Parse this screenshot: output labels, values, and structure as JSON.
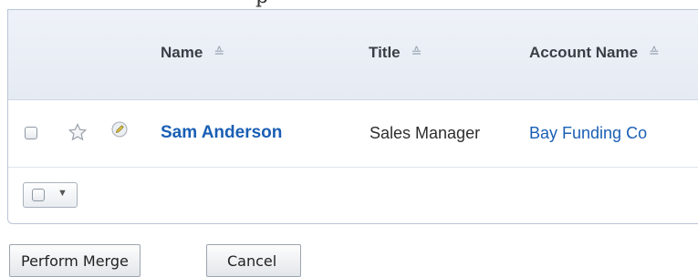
{
  "table": {
    "columns": [
      {
        "label": "Name"
      },
      {
        "label": "Title"
      },
      {
        "label": "Account Name"
      }
    ],
    "rows": [
      {
        "name": "Sam Anderson",
        "title": "Sales Manager",
        "account_name": "Bay Funding Co",
        "favorite": false
      }
    ]
  },
  "icons": {
    "sort": "sort-icon",
    "favorite": "star-icon",
    "edit": "pencil-edit-icon",
    "dropdown": "chevron-down-icon"
  },
  "colors": {
    "link": "#1a5fb4",
    "header_bg": "#eef2f8",
    "border": "#b8c4d6"
  },
  "actions": {
    "perform_merge_label": "Perform Merge",
    "cancel_label": "Cancel"
  }
}
